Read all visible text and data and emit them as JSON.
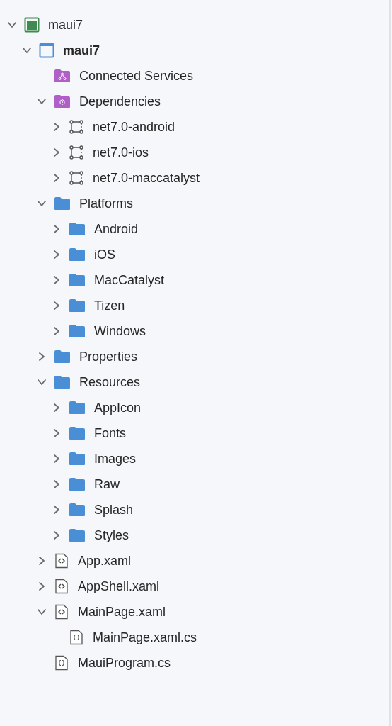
{
  "tree": [
    {
      "label": "maui7",
      "kind": "solution",
      "expanded": true,
      "children": [
        {
          "label": "maui7",
          "kind": "project",
          "expanded": true,
          "children": [
            {
              "label": "Connected Services",
              "kind": "services-folder"
            },
            {
              "label": "Dependencies",
              "kind": "dependencies-folder",
              "expanded": true,
              "children": [
                {
                  "label": "net7.0-android",
                  "kind": "framework",
                  "expanded": false
                },
                {
                  "label": "net7.0-ios",
                  "kind": "framework",
                  "expanded": false
                },
                {
                  "label": "net7.0-maccatalyst",
                  "kind": "framework",
                  "expanded": false
                }
              ]
            },
            {
              "label": "Platforms",
              "kind": "folder",
              "expanded": true,
              "children": [
                {
                  "label": "Android",
                  "kind": "folder",
                  "expanded": false
                },
                {
                  "label": "iOS",
                  "kind": "folder",
                  "expanded": false
                },
                {
                  "label": "MacCatalyst",
                  "kind": "folder",
                  "expanded": false
                },
                {
                  "label": "Tizen",
                  "kind": "folder",
                  "expanded": false
                },
                {
                  "label": "Windows",
                  "kind": "folder",
                  "expanded": false
                }
              ]
            },
            {
              "label": "Properties",
              "kind": "folder",
              "expanded": false
            },
            {
              "label": "Resources",
              "kind": "folder",
              "expanded": true,
              "children": [
                {
                  "label": "AppIcon",
                  "kind": "folder",
                  "expanded": false
                },
                {
                  "label": "Fonts",
                  "kind": "folder",
                  "expanded": false
                },
                {
                  "label": "Images",
                  "kind": "folder",
                  "expanded": false
                },
                {
                  "label": "Raw",
                  "kind": "folder",
                  "expanded": false
                },
                {
                  "label": "Splash",
                  "kind": "folder",
                  "expanded": false
                },
                {
                  "label": "Styles",
                  "kind": "folder",
                  "expanded": false
                }
              ]
            },
            {
              "label": "App.xaml",
              "kind": "xaml",
              "expanded": false
            },
            {
              "label": "AppShell.xaml",
              "kind": "xaml",
              "expanded": false
            },
            {
              "label": "MainPage.xaml",
              "kind": "xaml",
              "expanded": true,
              "children": [
                {
                  "label": "MainPage.xaml.cs",
                  "kind": "csharp"
                }
              ]
            },
            {
              "label": "MauiProgram.cs",
              "kind": "csharp"
            }
          ]
        }
      ]
    }
  ]
}
